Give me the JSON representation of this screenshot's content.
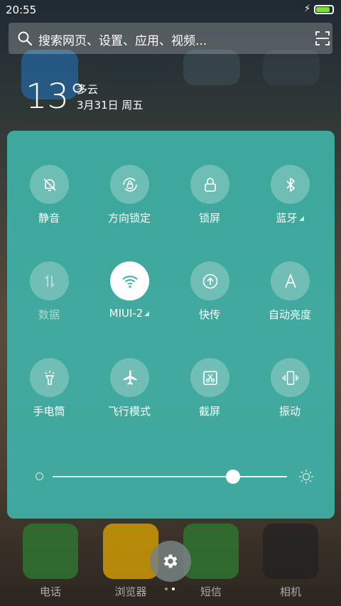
{
  "status_bar": {
    "time": "20:55",
    "battery_fraction": 0.95,
    "charging_glyph": "⚡",
    "battery_color": "#7be02b"
  },
  "search": {
    "placeholder": "搜索网页、设置、应用、视频..."
  },
  "weather": {
    "temperature": "13°",
    "condition": "多云",
    "date": "3月31日 周五"
  },
  "quick_settings": {
    "accent_color": "#3fb0a5",
    "tiles": [
      {
        "label": "静音",
        "icon": "bell-off-icon",
        "state": "off"
      },
      {
        "label": "方向锁定",
        "icon": "rotation-lock-icon",
        "state": "off"
      },
      {
        "label": "锁屏",
        "icon": "lock-icon",
        "state": "off"
      },
      {
        "label": "蓝牙",
        "icon": "bluetooth-icon",
        "state": "off",
        "has_more": true
      },
      {
        "label": "数据",
        "icon": "mobile-data-icon",
        "state": "disabled"
      },
      {
        "label": "MIUI-2",
        "icon": "wifi-icon",
        "state": "on",
        "has_more": true
      },
      {
        "label": "快传",
        "icon": "quick-transfer-icon",
        "state": "off"
      },
      {
        "label": "自动亮度",
        "icon": "auto-brightness-icon",
        "state": "off"
      },
      {
        "label": "手电筒",
        "icon": "flashlight-icon",
        "state": "off"
      },
      {
        "label": "飞行模式",
        "icon": "airplane-icon",
        "state": "off"
      },
      {
        "label": "截屏",
        "icon": "screenshot-icon",
        "state": "off"
      },
      {
        "label": "振动",
        "icon": "vibrate-icon",
        "state": "off"
      }
    ],
    "brightness_level": 0.77
  },
  "dock": {
    "apps": [
      {
        "label": "电话",
        "icon": "phone-icon",
        "color": "#2e7d32"
      },
      {
        "label": "浏览器",
        "icon": "browser-icon",
        "color": "#e0a800"
      },
      {
        "label": "短信",
        "icon": "message-icon",
        "color": "#2e7d32"
      },
      {
        "label": "相机",
        "icon": "camera-icon",
        "color": "#222222"
      }
    ]
  },
  "page_indicator": {
    "count": 2,
    "current": 2
  }
}
